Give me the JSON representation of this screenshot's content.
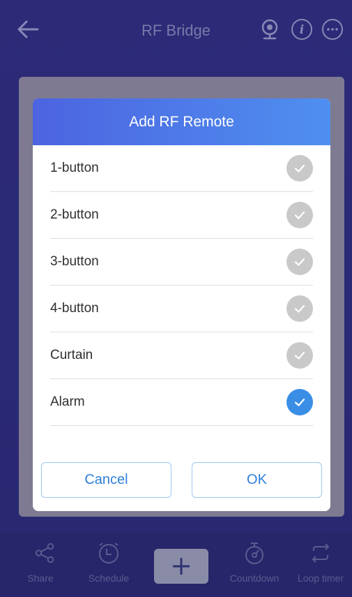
{
  "header": {
    "title": "RF Bridge",
    "icons": [
      "back-arrow-icon",
      "webcam-icon",
      "info-icon",
      "more-icon"
    ]
  },
  "dialog": {
    "title": "Add RF Remote",
    "options": [
      {
        "label": "1-button",
        "selected": false
      },
      {
        "label": "2-button",
        "selected": false
      },
      {
        "label": "3-button",
        "selected": false
      },
      {
        "label": "4-button",
        "selected": false
      },
      {
        "label": "Curtain",
        "selected": false
      },
      {
        "label": "Alarm",
        "selected": true
      }
    ],
    "cancel_label": "Cancel",
    "ok_label": "OK"
  },
  "toolbar": {
    "share_label": "Share",
    "schedule_label": "Schedule",
    "countdown_label": "Countdown",
    "loop_timer_label": "Loop timer"
  },
  "colors": {
    "accent": "#3a8ee6",
    "unselected_check": "#c9c9c9",
    "header_gradient_start": "#4c64e0",
    "header_gradient_end": "#4f8ff0"
  }
}
